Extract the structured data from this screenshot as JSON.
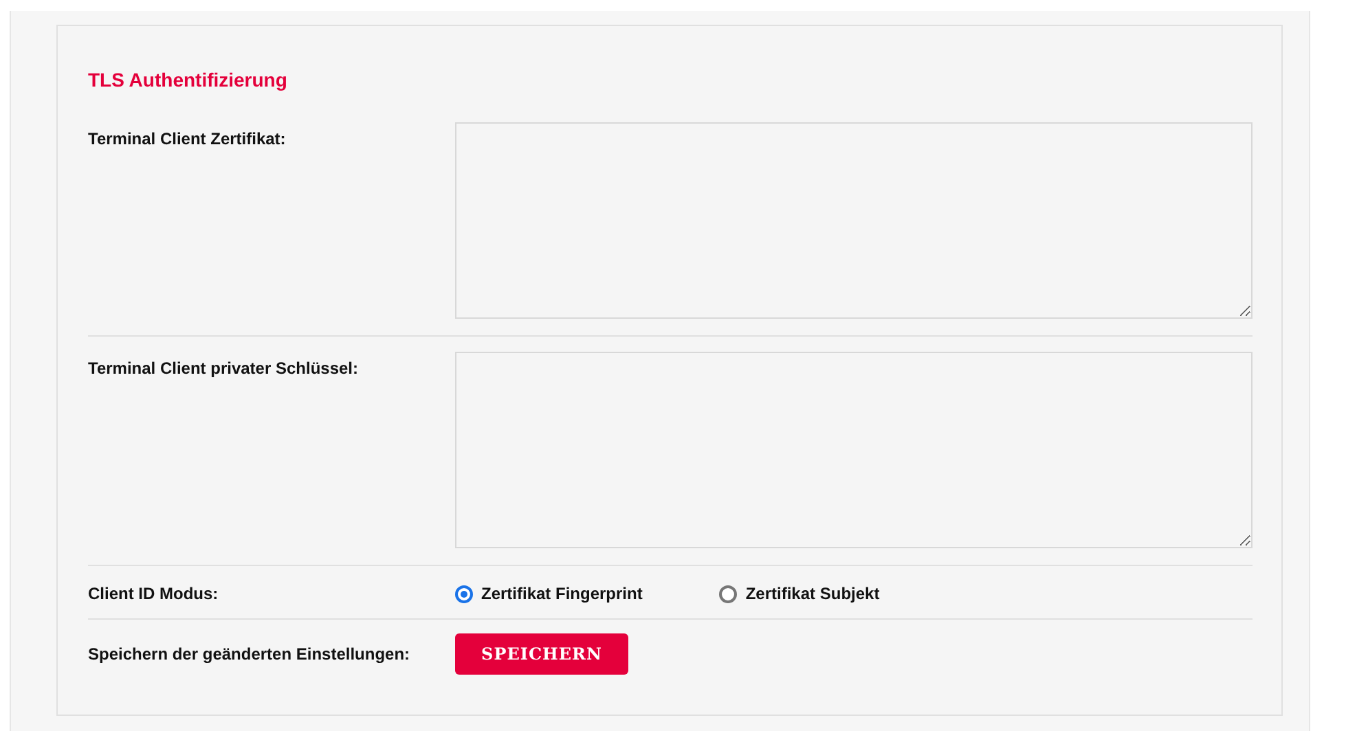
{
  "section": {
    "title": "TLS Authentifizierung"
  },
  "text_fields": [
    {
      "label": "Terminal Client Zertifikat:"
    },
    {
      "label": "Terminal Client privater Schlüssel:"
    }
  ],
  "client_id_mode": {
    "label": "Client ID Modus:",
    "options": [
      {
        "label": "Zertifikat Fingerprint",
        "selected": true
      },
      {
        "label": "Zertifikat Subjekt",
        "selected": false
      }
    ]
  },
  "save": {
    "label": "Speichern der geänderten Einstellungen:",
    "button": "SPEICHERN"
  }
}
